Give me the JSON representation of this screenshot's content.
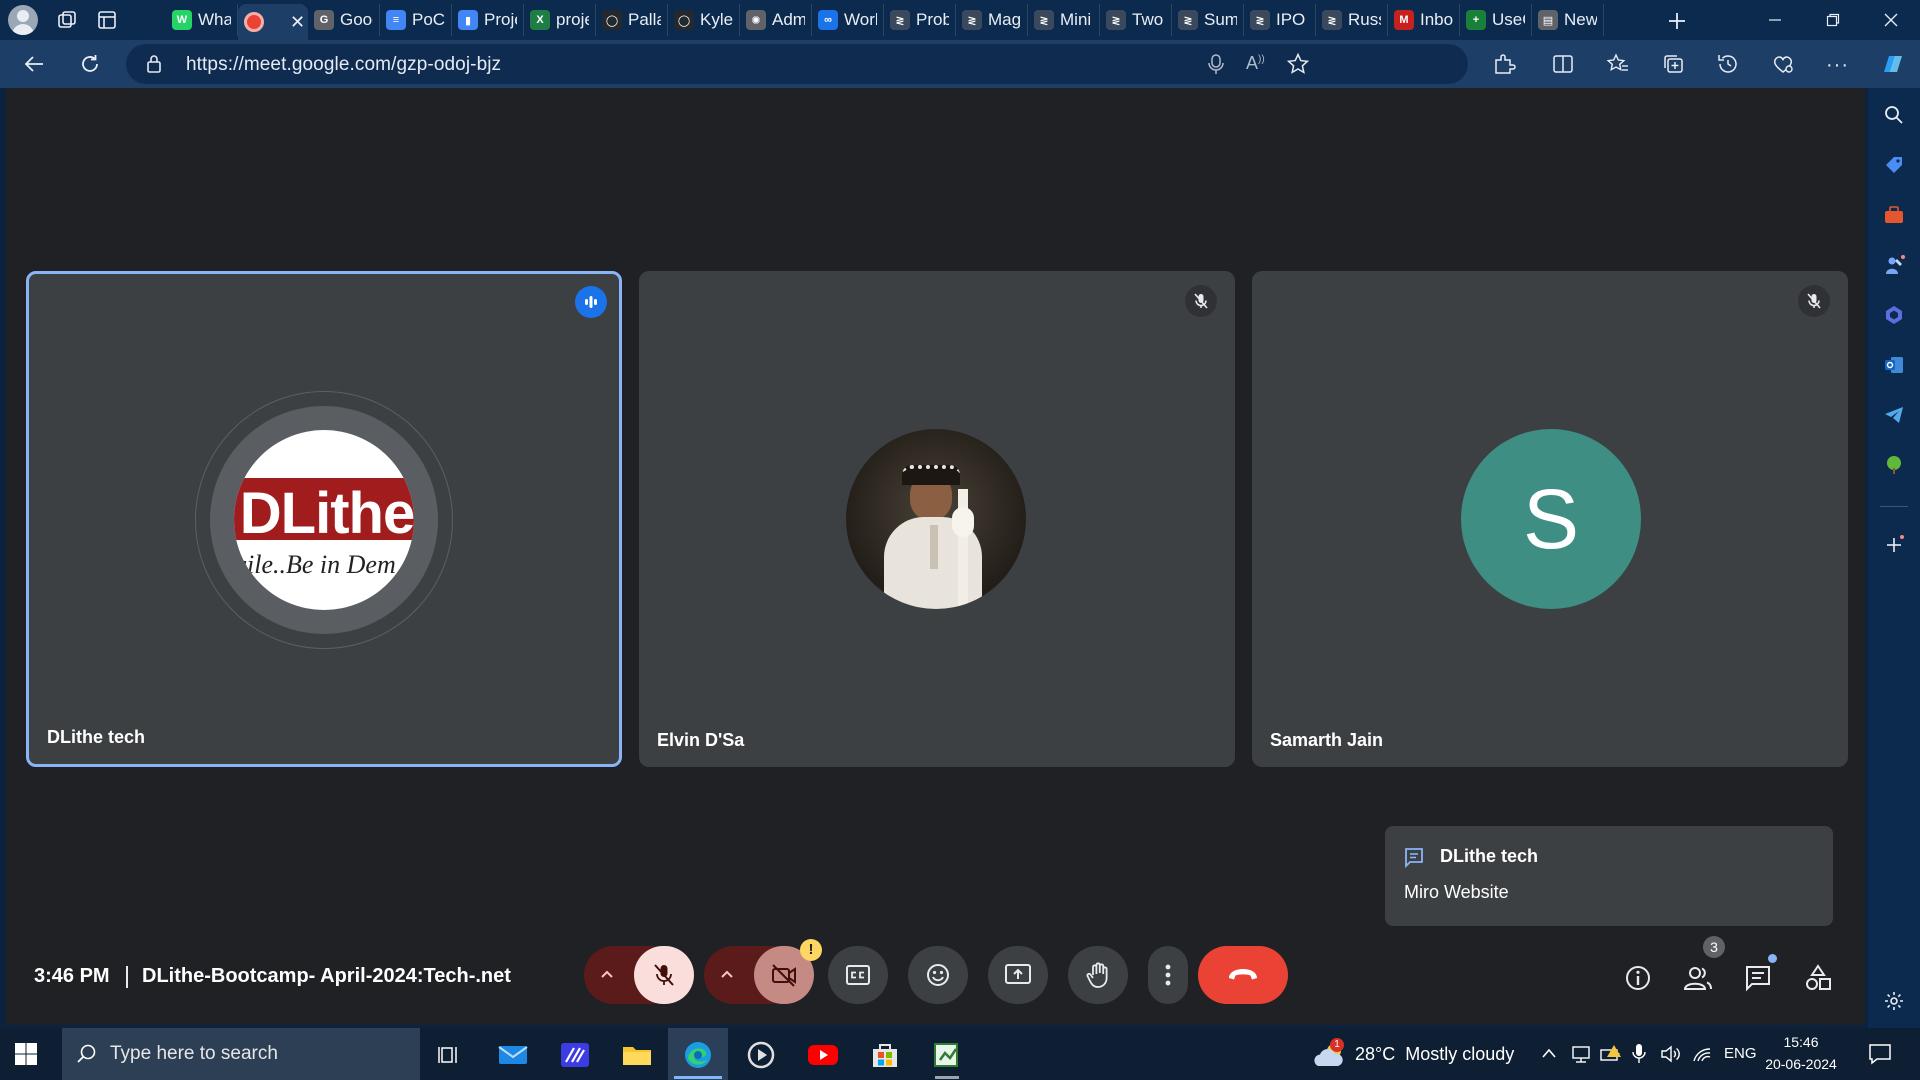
{
  "browser": {
    "tabs": [
      {
        "title": "What",
        "color": "#25d366",
        "glyph": "W"
      },
      {
        "title": "",
        "color": "#ea4335",
        "glyph": "",
        "active": true
      },
      {
        "title": "Goog",
        "color": "#5f6368",
        "glyph": "G"
      },
      {
        "title": "PoC",
        "color": "#4285f4",
        "glyph": "≡"
      },
      {
        "title": "Proje",
        "color": "#4285f4",
        "glyph": "▮"
      },
      {
        "title": "proje",
        "color": "#1e7e45",
        "glyph": "X"
      },
      {
        "title": "Palla",
        "color": "#24292e",
        "glyph": "◯"
      },
      {
        "title": "Kyler",
        "color": "#24292e",
        "glyph": "◯"
      },
      {
        "title": "Adm",
        "color": "#5f6368",
        "glyph": "✺"
      },
      {
        "title": "Worl",
        "color": "#1a73e8",
        "glyph": "∞"
      },
      {
        "title": "Prob",
        "color": "#3a4a5c",
        "glyph": "≷"
      },
      {
        "title": "Mag",
        "color": "#3a4a5c",
        "glyph": "≷"
      },
      {
        "title": "Mini",
        "color": "#3a4a5c",
        "glyph": "≷"
      },
      {
        "title": "Two",
        "color": "#3a4a5c",
        "glyph": "≷"
      },
      {
        "title": "Sum",
        "color": "#3a4a5c",
        "glyph": "≷"
      },
      {
        "title": "IPO",
        "color": "#3a4a5c",
        "glyph": "≷"
      },
      {
        "title": "Russ",
        "color": "#3a4a5c",
        "glyph": "≷"
      },
      {
        "title": "Inbo",
        "color": "#c5221f",
        "glyph": "M"
      },
      {
        "title": "UseC",
        "color": "#188038",
        "glyph": "+"
      },
      {
        "title": "New",
        "color": "#5f6368",
        "glyph": "▤"
      }
    ],
    "url": "https://meet.google.com/gzp-odoj-bjz"
  },
  "meeting": {
    "participants": [
      {
        "name": "DLithe tech",
        "avatar_text": "DLithe",
        "avatar_sub": "gile..Be in Dem",
        "speaking": true
      },
      {
        "name": "Elvin D'Sa",
        "muted": true
      },
      {
        "name": "Samarth Jain",
        "initial": "S",
        "avatar_color": "#3f8e84",
        "muted": true
      }
    ],
    "notification": {
      "sender": "DLithe tech",
      "message": "Miro Website"
    },
    "time": "3:46 PM",
    "title": "DLithe-Bootcamp- April-2024:Tech-.net",
    "people_count": "3",
    "camera_warning": "!"
  },
  "taskbar": {
    "search_placeholder": "Type here to search",
    "weather_badge": "1",
    "weather": "28°C  Mostly cloudy",
    "language": "ENG",
    "clock_time": "15:46",
    "clock_date": "20-06-2024"
  }
}
